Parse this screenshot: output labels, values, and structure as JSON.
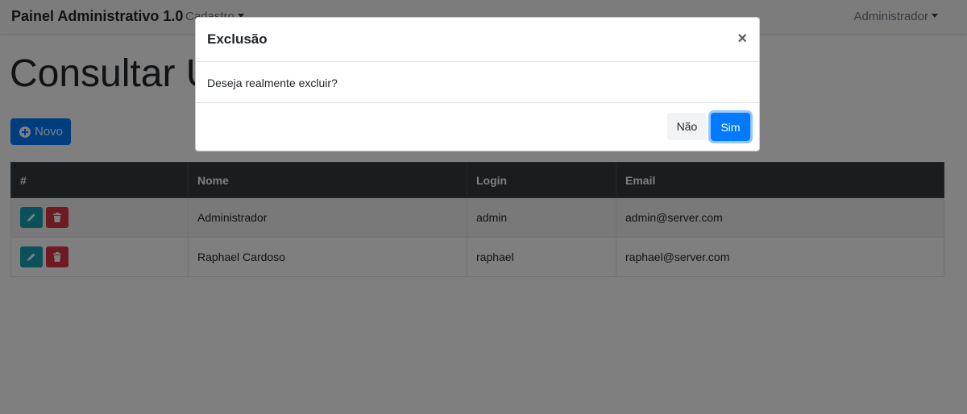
{
  "navbar": {
    "brand": "Painel Administrativo 1.0",
    "menu_cadastro": "Cadastro",
    "user_menu": "Administrador"
  },
  "page": {
    "title": "Consultar Usuários",
    "new_button": "Novo"
  },
  "table": {
    "headers": [
      "#",
      "Nome",
      "Login",
      "Email"
    ],
    "rows": [
      {
        "nome": "Administrador",
        "login": "admin",
        "email": "admin@server.com"
      },
      {
        "nome": "Raphael Cardoso",
        "login": "raphael",
        "email": "raphael@server.com"
      }
    ]
  },
  "modal": {
    "title": "Exclusão",
    "close": "×",
    "body": "Deseja realmente excluir?",
    "no_label": "Não",
    "yes_label": "Sim"
  },
  "icons": {
    "edit": "pencil-icon",
    "delete": "trash-icon",
    "new": "plus-circle-icon"
  },
  "colors": {
    "primary": "#007bff",
    "info": "#17a2b8",
    "danger": "#dc3545",
    "dark": "#343a40"
  }
}
